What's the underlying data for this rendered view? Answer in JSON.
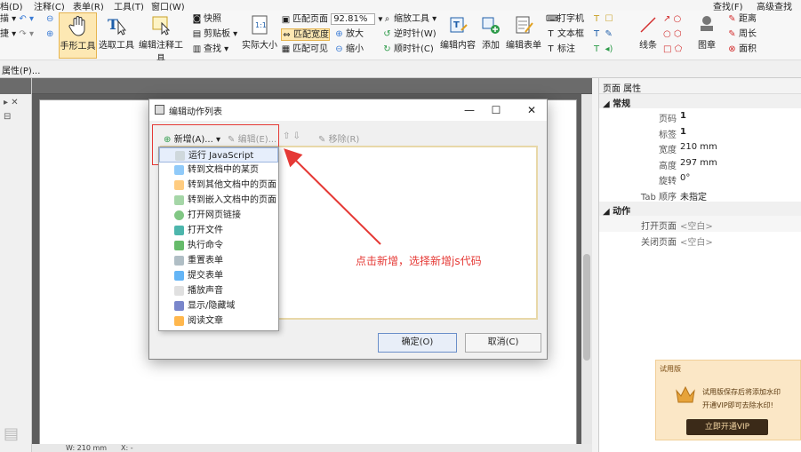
{
  "menubar": {
    "items": [
      "档(D)",
      "注释(C)",
      "表单(R)",
      "工具(T)",
      "窗口(W)"
    ],
    "right_items": [
      "查找(F)",
      "高级查找(S"
    ]
  },
  "ribbon": {
    "left_small": [
      "描 ▾",
      "捷 ▾"
    ],
    "hand_tool": "手形工具",
    "select_tool": "选取工具",
    "edit_annot_tool": "编辑注释工具",
    "snapshot": "快照",
    "clipboard": "剪贴板 ▾",
    "find": "查找 ▾",
    "actual_size": "实际大小",
    "fit_page": "匹配页面",
    "fit_width": "匹配宽度",
    "fit_visible": "匹配可见",
    "zoom_value": "92.81%",
    "zoom_in": "放大",
    "zoom_out": "缩小",
    "zoom_tool": "缩放工具 ▾",
    "rotate_ccw": "逆时针(W)",
    "rotate_cw": "顺时针(C)",
    "edit_content": "编辑内容",
    "add": "添加",
    "edit_form": "编辑表单",
    "typewriter": "打字机",
    "textbox": "文本框",
    "callout": "标注",
    "line": "线条",
    "stamp": "图章",
    "distance": "距离",
    "perimeter": "周长",
    "area": "面积"
  },
  "propbar": {
    "label": "属性(P)..."
  },
  "props_panel": {
    "title": "页面 属性",
    "section_general": "常规",
    "rows": [
      {
        "key": "页码",
        "value": "1"
      },
      {
        "key": "标签",
        "value": "1"
      },
      {
        "key": "宽度",
        "value": "210 mm"
      },
      {
        "key": "高度",
        "value": "297 mm"
      },
      {
        "key": "旋转",
        "value": "0°"
      },
      {
        "key": "Tab 顺序",
        "value": "未指定"
      }
    ],
    "section_actions": "动作",
    "action_rows": [
      {
        "key": "打开页面",
        "value": "<空白>"
      },
      {
        "key": "关闭页面",
        "value": "<空白>"
      }
    ]
  },
  "dialog": {
    "title": "编辑动作列表",
    "add_button": "新增(A)...",
    "edit_button": "编辑(E)...",
    "remove_button": "移除(R)",
    "ok": "确定(O)",
    "cancel": "取消(C)"
  },
  "dropmenu": {
    "items": [
      {
        "label": "运行 JavaScript",
        "icon": "script-icon"
      },
      {
        "label": "转到文档中的某页",
        "icon": "goto-page-icon"
      },
      {
        "label": "转到其他文档中的页面",
        "icon": "goto-other-doc-icon"
      },
      {
        "label": "转到嵌入文档中的页面",
        "icon": "goto-embedded-doc-icon"
      },
      {
        "label": "打开网页链接",
        "icon": "globe-icon"
      },
      {
        "label": "打开文件",
        "icon": "open-file-icon"
      },
      {
        "label": "执行命令",
        "icon": "command-icon"
      },
      {
        "label": "重置表单",
        "icon": "reset-form-icon"
      },
      {
        "label": "提交表单",
        "icon": "submit-form-icon"
      },
      {
        "label": "播放声音",
        "icon": "sound-icon"
      },
      {
        "label": "显示/隐藏域",
        "icon": "show-hide-icon"
      },
      {
        "label": "阅读文章",
        "icon": "article-icon"
      }
    ]
  },
  "annotation": "点击新增，选择新增js代码",
  "vip": {
    "label": "试用版",
    "line1": "试用版保存后将添加水印",
    "line2": "开通VIP即可去除水印!",
    "button": "立即开通VIP"
  },
  "statusbar": {
    "width": "W: 210 mm",
    "x": "X: -"
  },
  "colors": {
    "highlight_red": "#e53935",
    "active_tool": "#fde8b3",
    "vip_bg": "#fbe7c6"
  }
}
